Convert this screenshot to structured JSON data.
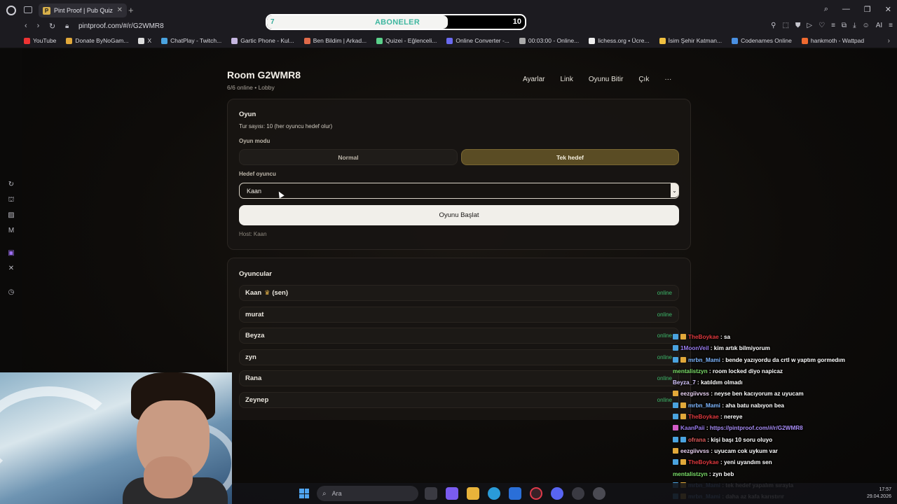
{
  "browser": {
    "tab_title": "Pint Proof | Pub Quiz",
    "tab_favicon_letter": "P",
    "url": "pintproof.com/#/r/G2WMR8",
    "bookmarks": [
      {
        "label": "YouTube",
        "color": "#e33"
      },
      {
        "label": "Donate ByNoGam...",
        "color": "#e1a83a"
      },
      {
        "label": "X",
        "color": "#ddd"
      },
      {
        "label": "ChatPlay - Twitch...",
        "color": "#4aa3df"
      },
      {
        "label": "Gartic Phone - Kul...",
        "color": "#c5b6e0"
      },
      {
        "label": "Ben Bildim | Arkad...",
        "color": "#e06a4a"
      },
      {
        "label": "Quizei - Eğlenceli...",
        "color": "#5ad08a"
      },
      {
        "label": "Online Converter -...",
        "color": "#6a6af0"
      },
      {
        "label": "00:03:00 - Online...",
        "color": "#aaa"
      },
      {
        "label": "lichess.org • Ücre...",
        "color": "#eee"
      },
      {
        "label": "İsim Şehir Katman...",
        "color": "#f0c040"
      },
      {
        "label": "Codenames Online",
        "color": "#4a90e2"
      },
      {
        "label": "hankmoth - Wattpad",
        "color": "#f06a30"
      }
    ]
  },
  "sub_goal": {
    "label": "ABONELER",
    "current": "7",
    "goal": "10",
    "progress": 0.7
  },
  "room": {
    "title": "Room G2WMR8",
    "subtitle": "6/6 online • Lobby",
    "actions": [
      "Ayarlar",
      "Link",
      "Oyunu Bitir",
      "Çık",
      "···"
    ]
  },
  "game": {
    "heading": "Oyun",
    "rounds_text": "Tur sayısı: 10 (her oyuncu hedef olur)",
    "mode_label": "Oyun modu",
    "mode_normal": "Normal",
    "mode_single": "Tek hedef",
    "selected_mode": "Tek hedef",
    "target_label": "Hedef oyuncu",
    "target_value": "Kaan",
    "start_button": "Oyunu Başlat",
    "host_text": "Host: Kaan"
  },
  "players": {
    "heading": "Oyuncular",
    "online_label": "online",
    "list": [
      {
        "name": "Kaan",
        "suffix": "(sen)",
        "host": true,
        "status": "online"
      },
      {
        "name": "murat",
        "suffix": "",
        "host": false,
        "status": "online"
      },
      {
        "name": "Beyza",
        "suffix": "",
        "host": false,
        "status": "online"
      },
      {
        "name": "zyn",
        "suffix": "",
        "host": false,
        "status": "online"
      },
      {
        "name": "Rana",
        "suffix": "",
        "host": false,
        "status": "online"
      },
      {
        "name": "Zeynep",
        "suffix": "",
        "host": false,
        "status": "online"
      }
    ]
  },
  "chat": [
    {
      "badges": [
        "blue",
        "gold"
      ],
      "user": "TheBoykae",
      "color": "#e0393e",
      "msg": "sa"
    },
    {
      "badges": [
        "blue"
      ],
      "user": "1MoonVeil",
      "color": "#9b7df0",
      "msg": "kim artık bilmiyorum"
    },
    {
      "badges": [
        "blue",
        "gold"
      ],
      "user": "mrbn_Mami",
      "color": "#7fb7ff",
      "msg": "bende yazıyordu da crtl w yaptım gormedım"
    },
    {
      "badges": [],
      "user": "mentalistzyn",
      "color": "#7de06a",
      "msg": "room locked diyo napicaz"
    },
    {
      "badges": [],
      "user": "Beyza_7",
      "color": "#d7c7ff",
      "msg": "katıldım olmadı"
    },
    {
      "badges": [
        "gold"
      ],
      "user": "eezgiivvss",
      "color": "#e8d0f0",
      "msg": "neyse ben kacıyorum az uyucam"
    },
    {
      "badges": [
        "blue",
        "gold"
      ],
      "user": "mrbn_Mami",
      "color": "#7fb7ff",
      "msg": "aha batu nabıyon bea"
    },
    {
      "badges": [
        "blue",
        "gold"
      ],
      "user": "TheBoykae",
      "color": "#e0393e",
      "msg": "nereye"
    },
    {
      "badges": [
        "pink"
      ],
      "user": "KaanPaii",
      "color": "#9b7df0",
      "msg": "https://pintproof.com/#/r/G2WMR8",
      "link": true
    },
    {
      "badges": [
        "blue",
        "blue"
      ],
      "user": "ofrana",
      "color": "#e05a5a",
      "msg": "kişi başı 10 soru oluyo"
    },
    {
      "badges": [
        "gold"
      ],
      "user": "eezgiivvss",
      "color": "#e8d0f0",
      "msg": "uyucam cok uykum var"
    },
    {
      "badges": [
        "blue",
        "gold"
      ],
      "user": "TheBoykae",
      "color": "#e0393e",
      "msg": "yeni uyandım sen"
    },
    {
      "badges": [],
      "user": "mentalistzyn",
      "color": "#7de06a",
      "msg": "zyn beb"
    },
    {
      "badges": [
        "blue",
        "gold"
      ],
      "user": "mrbn_Mami",
      "color": "#7fb7ff",
      "msg": "tek hedef yapalım sırayla"
    },
    {
      "badges": [
        "blue",
        "gold"
      ],
      "user": "mrbn_Mami",
      "color": "#7fb7ff",
      "msg": "daha az kafa karıstırır"
    }
  ],
  "taskbar": {
    "search_placeholder": "Ara",
    "time": "17:57",
    "date": "29.04.2026"
  }
}
